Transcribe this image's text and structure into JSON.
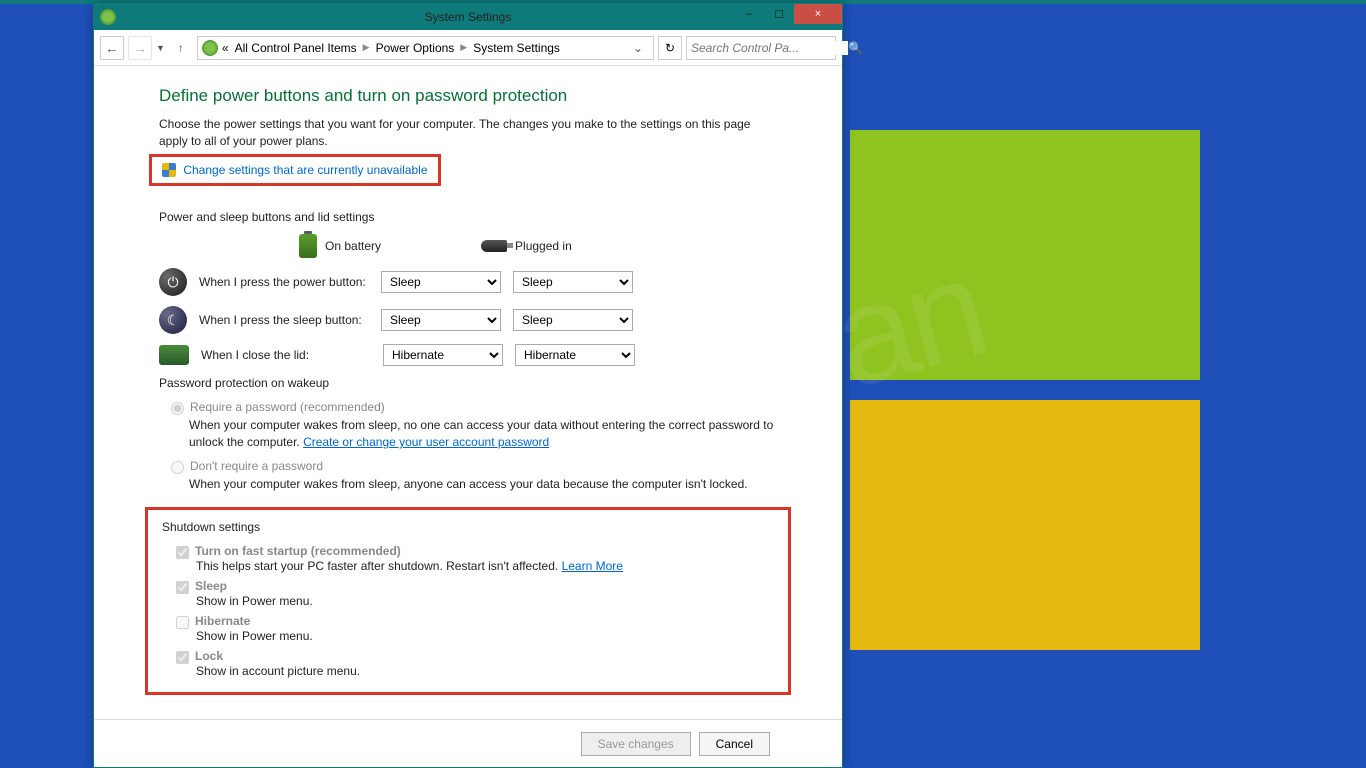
{
  "window": {
    "title": "System Settings",
    "minimize": "–",
    "maximize": "☐",
    "close": "×"
  },
  "nav": {
    "back": "←",
    "forward": "→",
    "up": "↑",
    "bc_prefix": "«",
    "bc1": "All Control Panel Items",
    "bc2": "Power Options",
    "bc3": "System Settings",
    "refresh": "↻",
    "search_ph": "Search Control Pa...",
    "search_icon": "🔍"
  },
  "page": {
    "heading": "Define power buttons and turn on password protection",
    "intro": "Choose the power settings that you want for your computer. The changes you make to the settings on this page apply to all of your power plans.",
    "change_link": "Change settings that are currently unavailable",
    "sec1": "Power and sleep buttons and lid settings",
    "col_battery": "On battery",
    "col_plugged": "Plugged in",
    "row_power": "When I press the power button:",
    "row_sleep": "When I press the sleep button:",
    "row_lid": "When I close the lid:",
    "opt_sleep": "Sleep",
    "opt_hibernate": "Hibernate",
    "sel_power_bat": "Sleep",
    "sel_power_plug": "Sleep",
    "sel_sleep_bat": "Sleep",
    "sel_sleep_plug": "Sleep",
    "sel_lid_bat": "Hibernate",
    "sel_lid_plug": "Hibernate",
    "sec2": "Password protection on wakeup",
    "radio1": "Require a password (recommended)",
    "radio1_desc_a": "When your computer wakes from sleep, no one can access your data without entering the correct password to unlock the computer. ",
    "radio1_link": "Create or change your user account password",
    "radio2": "Don't require a password",
    "radio2_desc": "When your computer wakes from sleep, anyone can access your data because the computer isn't locked.",
    "sec3": "Shutdown settings",
    "chk1": "Turn on fast startup (recommended)",
    "chk1_desc_a": "This helps start your PC faster after shutdown. Restart isn't affected. ",
    "chk1_link": "Learn More",
    "chk2": "Sleep",
    "chk2_desc": "Show in Power menu.",
    "chk3": "Hibernate",
    "chk3_desc": "Show in Power menu.",
    "chk4": "Lock",
    "chk4_desc": "Show in account picture menu."
  },
  "footer": {
    "save": "Save changes",
    "cancel": "Cancel"
  },
  "watermark": "fsetiyawan"
}
